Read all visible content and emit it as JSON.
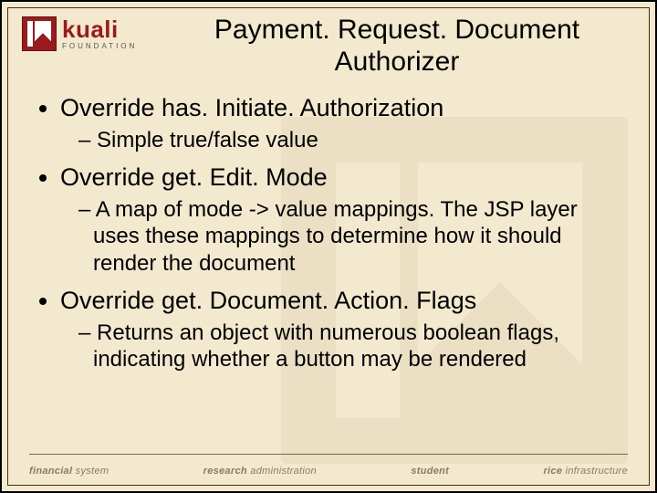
{
  "logo": {
    "word": "kuali",
    "sub": "FOUNDATION"
  },
  "title": {
    "line1": "Payment. Request. Document",
    "line2": "Authorizer"
  },
  "bullets": {
    "b1": "Override has. Initiate. Authorization",
    "b1s1": "Simple true/false value",
    "b2": "Override get. Edit. Mode",
    "b2s1": "A map of mode -> value mappings.  The JSP layer uses these mappings to determine how it should render the document",
    "b3": "Override get. Document. Action. Flags",
    "b3s1": "Returns an object with numerous boolean flags, indicating whether a button may be rendered"
  },
  "footer": {
    "f1a": "financial",
    "f1b": " system",
    "f2a": "research",
    "f2b": " administration",
    "f3a": "student",
    "f4a": "rice",
    "f4b": " infrastructure"
  }
}
